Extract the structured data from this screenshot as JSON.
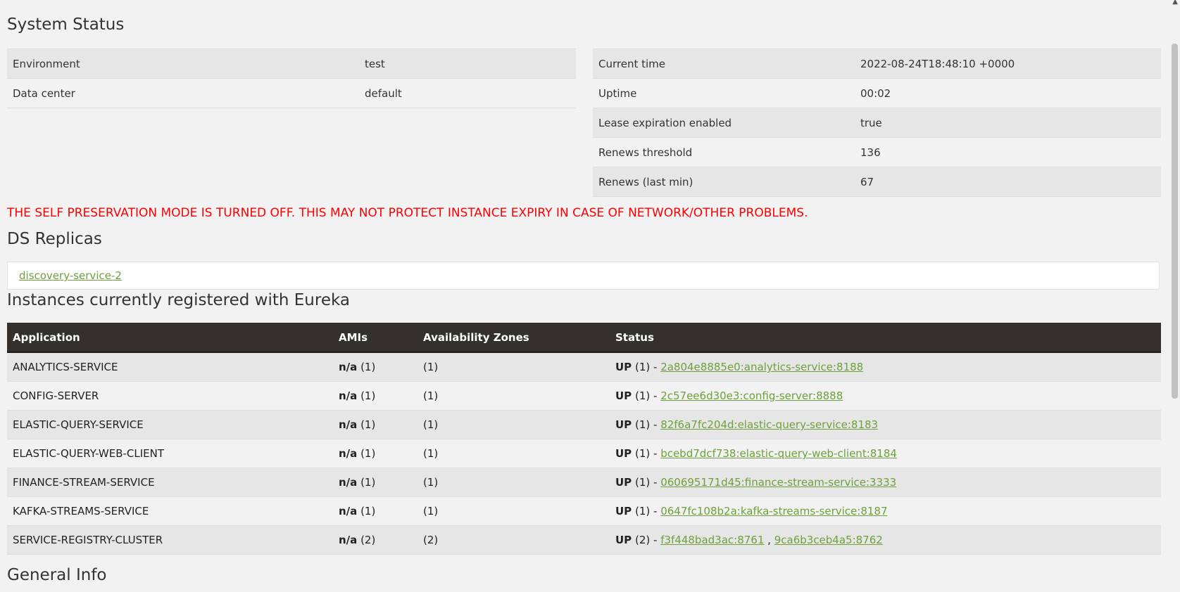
{
  "system_status": {
    "title": "System Status",
    "left": [
      {
        "key": "Environment",
        "value": "test"
      },
      {
        "key": "Data center",
        "value": "default"
      }
    ],
    "right": [
      {
        "key": "Current time",
        "value": "2022-08-24T18:48:10 +0000"
      },
      {
        "key": "Uptime",
        "value": "00:02"
      },
      {
        "key": "Lease expiration enabled",
        "value": "true"
      },
      {
        "key": "Renews threshold",
        "value": "136"
      },
      {
        "key": "Renews (last min)",
        "value": "67"
      }
    ]
  },
  "warning": "THE SELF PRESERVATION MODE IS TURNED OFF. THIS MAY NOT PROTECT INSTANCE EXPIRY IN CASE OF NETWORK/OTHER PROBLEMS.",
  "replicas": {
    "title": "DS Replicas",
    "items": [
      "discovery-service-2"
    ]
  },
  "instances": {
    "title": "Instances currently registered with Eureka",
    "headers": [
      "Application",
      "AMIs",
      "Availability Zones",
      "Status"
    ],
    "rows": [
      {
        "app": "ANALYTICS-SERVICE",
        "ami": "n/a",
        "ami_count": "(1)",
        "zones": "(1)",
        "status": "UP",
        "status_count": "(1) -",
        "links": [
          "2a804e8885e0:analytics-service:8188"
        ]
      },
      {
        "app": "CONFIG-SERVER",
        "ami": "n/a",
        "ami_count": "(1)",
        "zones": "(1)",
        "status": "UP",
        "status_count": "(1) -",
        "links": [
          "2c57ee6d30e3:config-server:8888"
        ]
      },
      {
        "app": "ELASTIC-QUERY-SERVICE",
        "ami": "n/a",
        "ami_count": "(1)",
        "zones": "(1)",
        "status": "UP",
        "status_count": "(1) -",
        "links": [
          "82f6a7fc204d:elastic-query-service:8183"
        ]
      },
      {
        "app": "ELASTIC-QUERY-WEB-CLIENT",
        "ami": "n/a",
        "ami_count": "(1)",
        "zones": "(1)",
        "status": "UP",
        "status_count": "(1) -",
        "links": [
          "bcebd7dcf738:elastic-query-web-client:8184"
        ]
      },
      {
        "app": "FINANCE-STREAM-SERVICE",
        "ami": "n/a",
        "ami_count": "(1)",
        "zones": "(1)",
        "status": "UP",
        "status_count": "(1) -",
        "links": [
          "060695171d45:finance-stream-service:3333"
        ]
      },
      {
        "app": "KAFKA-STREAMS-SERVICE",
        "ami": "n/a",
        "ami_count": "(1)",
        "zones": "(1)",
        "status": "UP",
        "status_count": "(1) -",
        "links": [
          "0647fc108b2a:kafka-streams-service:8187"
        ]
      },
      {
        "app": "SERVICE-REGISTRY-CLUSTER",
        "ami": "n/a",
        "ami_count": "(2)",
        "zones": "(2)",
        "status": "UP",
        "status_count": "(2) -",
        "links": [
          "f3f448bad3ac:8761",
          "9ca6b3ceb4a5:8762"
        ]
      }
    ],
    "link_separator": ","
  },
  "general_info": {
    "title": "General Info"
  },
  "colors": {
    "link": "#6da13a",
    "warning": "#ff0000",
    "header_bg": "#34302d"
  }
}
